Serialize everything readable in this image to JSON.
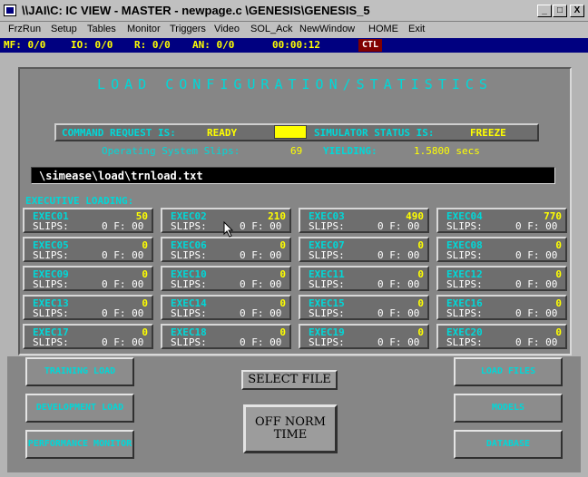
{
  "window": {
    "title": "\\\\JAI\\C:  IC VIEW - MASTER - newpage.c \\GENESIS\\GENESIS_5",
    "minimize_glyph": "_",
    "maximize_glyph": "□",
    "close_glyph": "X"
  },
  "menu": [
    "FrzRun",
    "Setup",
    "Tables",
    "Monitor",
    "Triggers",
    "Video",
    "SOL_Ack",
    "NewWindow",
    "HOME",
    "Exit"
  ],
  "status": {
    "mf": "MF: 0/0",
    "io": "IO: 0/0",
    "r": "R: 0/0",
    "an": "AN: 0/0",
    "time": "00:00:12",
    "ctl": "CTL"
  },
  "page": {
    "title": "LOAD CONFIGURATION/STATISTICS",
    "command_label": "COMMAND REQUEST IS:",
    "command_value": "READY",
    "simulator_label": "SIMULATOR STATUS IS:",
    "simulator_value": "FREEZE",
    "os_slips_label": "Operating System Slips:",
    "os_slips_value": "69",
    "yielding_label": "YIELDING:",
    "yielding_value": "1.5800 secs",
    "load_path": "\\simease\\load\\trnload.txt",
    "exec_loading_label": "EXECUTIVE LOADING:"
  },
  "executives": [
    {
      "name": "EXEC01",
      "value": "50",
      "slips": "SLIPS:",
      "slips_val": "0 F: 00"
    },
    {
      "name": "EXEC02",
      "value": "210",
      "slips": "SLIPS:",
      "slips_val": "0 F: 00"
    },
    {
      "name": "EXEC03",
      "value": "490",
      "slips": "SLIPS:",
      "slips_val": "0 F: 00"
    },
    {
      "name": "EXEC04",
      "value": "770",
      "slips": "SLIPS:",
      "slips_val": "0 F: 00"
    },
    {
      "name": "EXEC05",
      "value": "0",
      "slips": "SLIPS:",
      "slips_val": "0 F: 00"
    },
    {
      "name": "EXEC06",
      "value": "0",
      "slips": "SLIPS:",
      "slips_val": "0 F: 00"
    },
    {
      "name": "EXEC07",
      "value": "0",
      "slips": "SLIPS:",
      "slips_val": "0 F: 00"
    },
    {
      "name": "EXEC08",
      "value": "0",
      "slips": "SLIPS:",
      "slips_val": "0 F: 00"
    },
    {
      "name": "EXEC09",
      "value": "0",
      "slips": "SLIPS:",
      "slips_val": "0 F: 00"
    },
    {
      "name": "EXEC10",
      "value": "0",
      "slips": "SLIPS:",
      "slips_val": "0 F: 00"
    },
    {
      "name": "EXEC11",
      "value": "0",
      "slips": "SLIPS:",
      "slips_val": "0 F: 00"
    },
    {
      "name": "EXEC12",
      "value": "0",
      "slips": "SLIPS:",
      "slips_val": "0 F: 00"
    },
    {
      "name": "EXEC13",
      "value": "0",
      "slips": "SLIPS:",
      "slips_val": "0 F: 00"
    },
    {
      "name": "EXEC14",
      "value": "0",
      "slips": "SLIPS:",
      "slips_val": "0 F: 00"
    },
    {
      "name": "EXEC15",
      "value": "0",
      "slips": "SLIPS:",
      "slips_val": "0 F: 00"
    },
    {
      "name": "EXEC16",
      "value": "0",
      "slips": "SLIPS:",
      "slips_val": "0 F: 00"
    },
    {
      "name": "EXEC17",
      "value": "0",
      "slips": "SLIPS:",
      "slips_val": "0 F: 00"
    },
    {
      "name": "EXEC18",
      "value": "0",
      "slips": "SLIPS:",
      "slips_val": "0 F: 00"
    },
    {
      "name": "EXEC19",
      "value": "0",
      "slips": "SLIPS:",
      "slips_val": "0 F: 00"
    },
    {
      "name": "EXEC20",
      "value": "0",
      "slips": "SLIPS:",
      "slips_val": "0 F: 00"
    }
  ],
  "buttons": {
    "training_load": "TRAINING LOAD",
    "development_load": "DEVELOPMENT LOAD",
    "performance_monitor": "PERFORMANCE MONITOR",
    "select_file": "SELECT FILE",
    "off_norm_line1": "OFF NORM",
    "off_norm_line2": "TIME",
    "load_files": "LOAD FILES",
    "models": "MODELS",
    "database": "DATABASE"
  },
  "colors": {
    "status_bar": "#000080",
    "label_cyan": "#00d8d8",
    "value_yellow": "#ffff00",
    "ctl_badge": "#800000"
  },
  "icons": [
    "app-icon",
    "minimize-icon",
    "maximize-icon",
    "close-icon",
    "mouse-pointer-icon"
  ]
}
